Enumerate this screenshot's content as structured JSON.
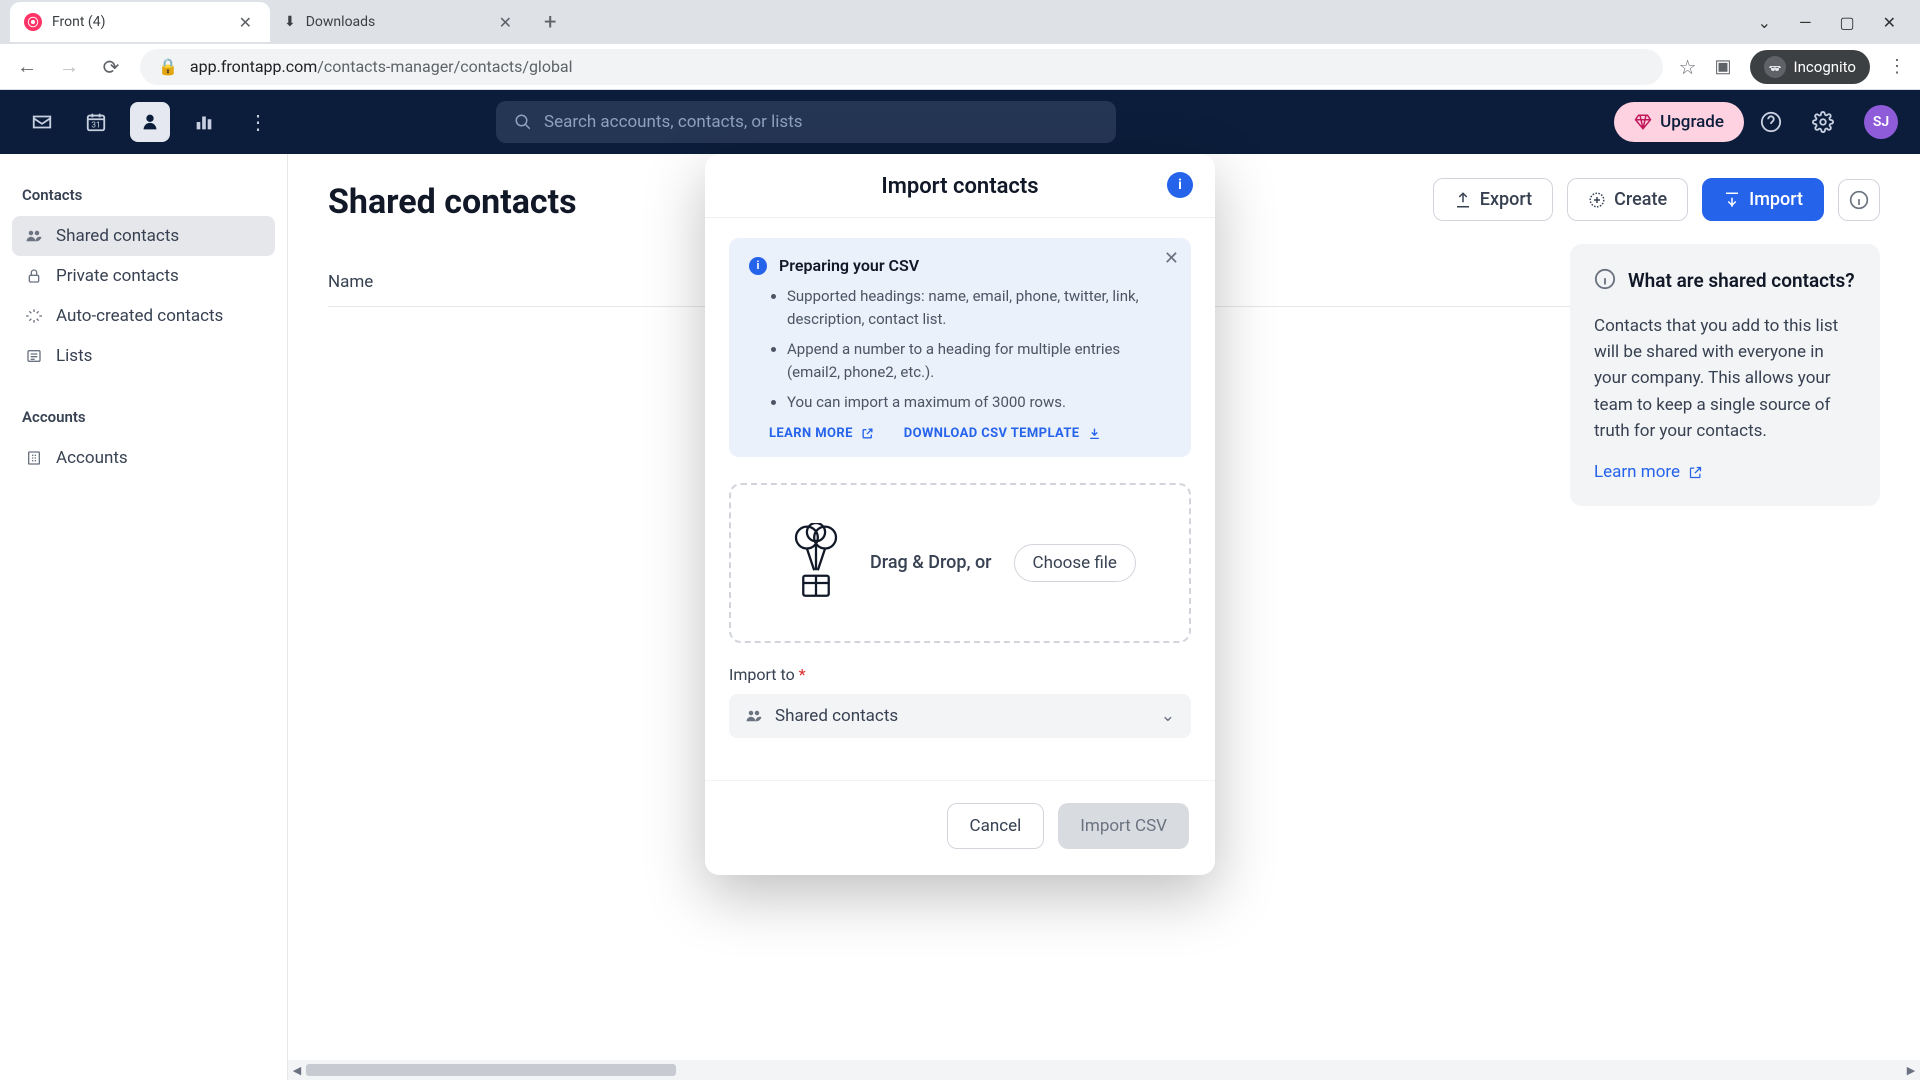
{
  "browser": {
    "tabs": [
      {
        "title": "Front (4)",
        "active": true
      },
      {
        "title": "Downloads",
        "active": false
      }
    ],
    "url_host": "app.frontapp.com",
    "url_path": "/contacts-manager/contacts/global",
    "incognito_label": "Incognito"
  },
  "header": {
    "search_placeholder": "Search accounts, contacts, or lists",
    "upgrade_label": "Upgrade",
    "avatar_initials": "SJ"
  },
  "sidebar": {
    "section_contacts": "Contacts",
    "items_contacts": [
      {
        "label": "Shared contacts",
        "active": true
      },
      {
        "label": "Private contacts",
        "active": false
      },
      {
        "label": "Auto-created contacts",
        "active": false
      },
      {
        "label": "Lists",
        "active": false
      }
    ],
    "section_accounts": "Accounts",
    "items_accounts": [
      {
        "label": "Accounts"
      }
    ]
  },
  "main": {
    "title": "Shared contacts",
    "export_label": "Export",
    "create_label": "Create",
    "import_label": "Import",
    "table_col_name": "Name"
  },
  "info_panel": {
    "title": "What are shared contacts?",
    "body": "Contacts that you add to this list will be shared with everyone in your company. This allows your team to keep a single source of truth for your contacts.",
    "learn_more": "Learn more"
  },
  "modal": {
    "title": "Import contacts",
    "tip_heading": "Preparing your CSV",
    "tip_items": [
      "Supported headings: name, email, phone, twitter, link, description, contact list.",
      "Append a number to a heading for multiple entries (email2, phone2, etc.).",
      "You can import a maximum of 3000 rows."
    ],
    "learn_more_label": "LEARN MORE",
    "download_template_label": "DOWNLOAD CSV TEMPLATE",
    "drop_text": "Drag & Drop, or",
    "choose_file_label": "Choose file",
    "import_to_label": "Import to",
    "import_to_value": "Shared contacts",
    "cancel_label": "Cancel",
    "import_csv_label": "Import CSV"
  }
}
